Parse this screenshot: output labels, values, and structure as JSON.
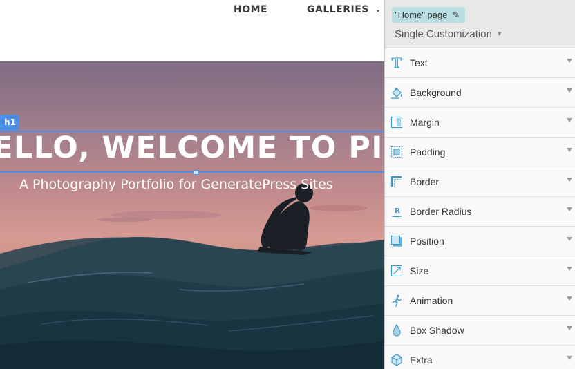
{
  "site": {
    "nav": {
      "home": "HOME",
      "galleries": "GALLERIES"
    },
    "hero": {
      "title": "ELLO, WELCOME TO PIX",
      "subtitle": "A Photography Portfolio for GeneratePress Sites"
    },
    "selection": {
      "tag": "h1",
      "color": "#4a8ee8"
    }
  },
  "panel": {
    "page_chip": "\"Home\" page",
    "mode": "Single Customization",
    "items": [
      {
        "label": "Text",
        "icon": "text-icon"
      },
      {
        "label": "Background",
        "icon": "paint-bucket-icon"
      },
      {
        "label": "Margin",
        "icon": "margin-icon"
      },
      {
        "label": "Padding",
        "icon": "padding-icon"
      },
      {
        "label": "Border",
        "icon": "border-icon"
      },
      {
        "label": "Border Radius",
        "icon": "border-radius-icon"
      },
      {
        "label": "Position",
        "icon": "position-icon"
      },
      {
        "label": "Size",
        "icon": "size-icon"
      },
      {
        "label": "Animation",
        "icon": "animation-icon"
      },
      {
        "label": "Box Shadow",
        "icon": "box-shadow-icon"
      },
      {
        "label": "Extra",
        "icon": "cube-icon"
      }
    ],
    "accent_color": "#3a98c9",
    "chip_color": "#b9dfe3"
  }
}
